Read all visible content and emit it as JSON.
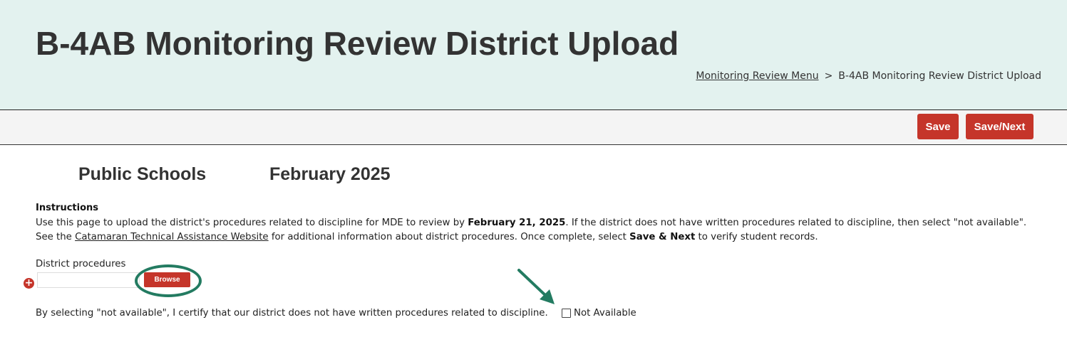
{
  "header": {
    "title": "B-4AB Monitoring Review District Upload",
    "breadcrumb": {
      "link": "Monitoring Review Menu",
      "separator": ">",
      "current": "B-4AB Monitoring Review District Upload"
    }
  },
  "toolbar": {
    "save_label": "Save",
    "save_next_label": "Save/Next"
  },
  "meta": {
    "organization": "Public Schools",
    "period": "February 2025"
  },
  "instructions": {
    "heading": "Instructions",
    "text_1": "Use this page to upload the district's procedures related to discipline for MDE to review by ",
    "deadline": "February 21, 2025",
    "text_2": ". If the district does not have written procedures related to discipline, then select \"not available\". See the ",
    "link": "Catamaran Technical Assistance Website",
    "text_3": " for additional information about district procedures. Once complete, select ",
    "action": "Save & Next",
    "text_4": " to verify student records."
  },
  "upload": {
    "label": "District procedures",
    "browse_label": "Browse",
    "add_icon": "plus-circle-icon"
  },
  "not_available": {
    "certification_text": "By selecting \"not available\", I certify that our district does not have written procedures related to discipline.",
    "checkbox_label": "Not Available",
    "checked": false
  },
  "colors": {
    "header_bg": "#e3f2ef",
    "accent": "#c5352a",
    "annotation": "#237b61"
  }
}
